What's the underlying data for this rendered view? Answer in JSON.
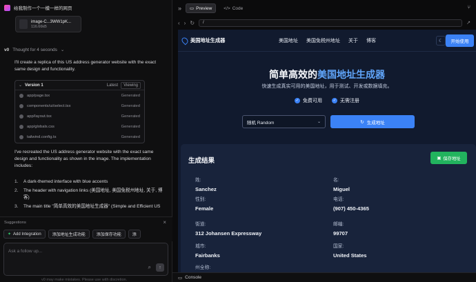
{
  "chat": {
    "title": "给我制作一个一模一样的网页",
    "attachment": {
      "name": "image-C...3WW1pK...",
      "size": "116.66kB"
    },
    "thought": "Thought for 4 seconds",
    "intro": "I'll create a replica of this US address generator website with the exact same design and functionality.",
    "version": {
      "title": "Version 1",
      "latest": "Latest",
      "viewing": "Viewing",
      "files": [
        {
          "name": "app/page.tsx",
          "status": "Generated"
        },
        {
          "name": "components/ui/select.tsx",
          "status": "Generated"
        },
        {
          "name": "app/layout.tsx",
          "status": "Generated"
        },
        {
          "name": "app/globals.css",
          "status": "Generated"
        },
        {
          "name": "tailwind.config.ts",
          "status": "Generated"
        }
      ]
    },
    "recap": "I've recreated the US address generator website with the exact same design and functionality as shown in the image. The implementation includes:",
    "list": [
      {
        "num": "1.",
        "text": "A dark-themed interface with blue accents"
      },
      {
        "num": "2.",
        "text": "The header with navigation links (美国地址, 美国免税州地址, 关于, 博客)"
      },
      {
        "num": "3.",
        "text": "The main title \"简单高效的美国地址生成器\" (Simple and Efficient US"
      }
    ],
    "suggestions_label": "Suggestions",
    "chips": [
      "Add Integration",
      "添加地址生成功能",
      "添加保存功能",
      "添"
    ],
    "input_placeholder": "Ask a follow up...",
    "disclaimer": "v0 may make mistakes. Please use with discretion."
  },
  "preview": {
    "tabs": {
      "preview": "Preview",
      "code": "Code"
    },
    "url": "/",
    "console": "Console"
  },
  "site": {
    "brand": "美国地址生成器",
    "menu": [
      "美国地址",
      "美国免税州地址",
      "关于",
      "博客"
    ],
    "start_button": "开始使用",
    "hero_title_pre": "简单高效的",
    "hero_title_hl": "美国地址生成器",
    "hero_sub": "快速生成真实可用的美国地址，用于测试、开发或数据填充。",
    "badges": [
      "免费可用",
      "无需注册"
    ],
    "select_value": "随机 Random",
    "generate_button": "生成地址",
    "result_title": "生成结果",
    "save_button": "保存地址",
    "fields": [
      {
        "label": "姓:",
        "value": "Sanchez"
      },
      {
        "label": "名:",
        "value": "Miguel"
      },
      {
        "label": "性别:",
        "value": "Female"
      },
      {
        "label": "电话:",
        "value": "(907) 450-4365"
      },
      {
        "label": "街道:",
        "value": "312 Johansen Expressway"
      },
      {
        "label": "邮编:",
        "value": "99707"
      },
      {
        "label": "城市:",
        "value": "Fairbanks"
      },
      {
        "label": "国家:",
        "value": "United States"
      },
      {
        "label": "州全称:",
        "value": ""
      }
    ]
  },
  "colors": {
    "accent": "#3b82f6",
    "save": "#22b35e",
    "site_bg": "#111a2e",
    "card_bg": "#18233b"
  }
}
